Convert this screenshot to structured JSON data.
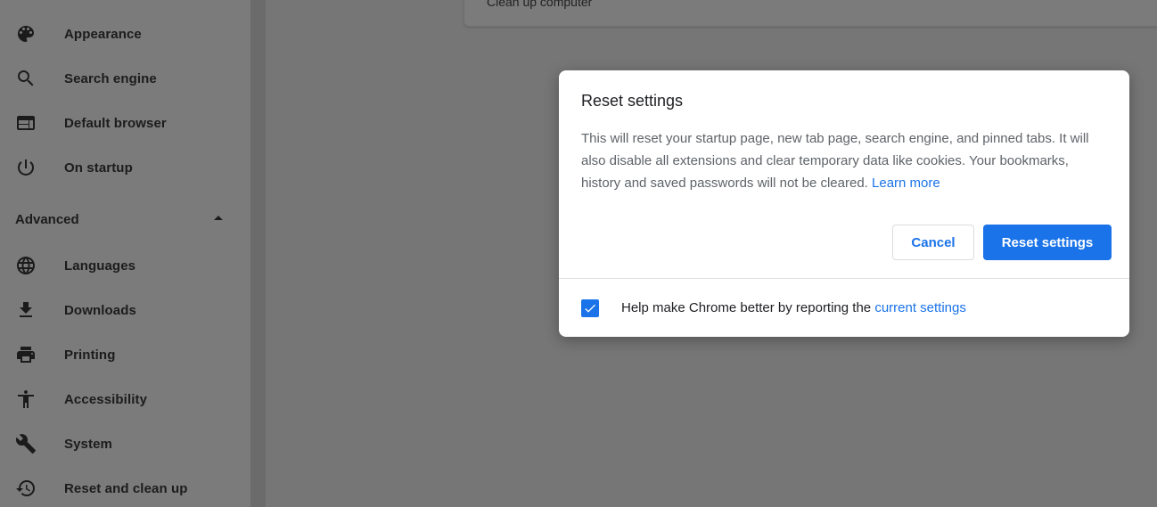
{
  "sidebar": {
    "items_top": [
      {
        "label": "Appearance",
        "icon": "palette-icon"
      },
      {
        "label": "Search engine",
        "icon": "search-icon"
      },
      {
        "label": "Default browser",
        "icon": "browser-icon"
      },
      {
        "label": "On startup",
        "icon": "power-icon"
      }
    ],
    "advanced_label": "Advanced",
    "items_advanced": [
      {
        "label": "Languages",
        "icon": "globe-icon"
      },
      {
        "label": "Downloads",
        "icon": "download-icon"
      },
      {
        "label": "Printing",
        "icon": "printer-icon"
      },
      {
        "label": "Accessibility",
        "icon": "accessibility-icon"
      },
      {
        "label": "System",
        "icon": "wrench-icon"
      },
      {
        "label": "Reset and clean up",
        "icon": "history-icon"
      }
    ]
  },
  "main": {
    "partial_card_label": "Clean up computer"
  },
  "dialog": {
    "title": "Reset settings",
    "body": "This will reset your startup page, new tab page, search engine, and pinned tabs. It will also disable all extensions and clear temporary data like cookies. Your bookmarks, history and saved passwords will not be cleared.",
    "learn_more": "Learn more",
    "cancel_label": "Cancel",
    "reset_label": "Reset settings",
    "checkbox_checked": true,
    "checkbox_text": "Help make Chrome better by reporting the",
    "checkbox_link": "current settings"
  },
  "colors": {
    "accent": "#1a73e8",
    "overlay": "#7a7a7a"
  }
}
